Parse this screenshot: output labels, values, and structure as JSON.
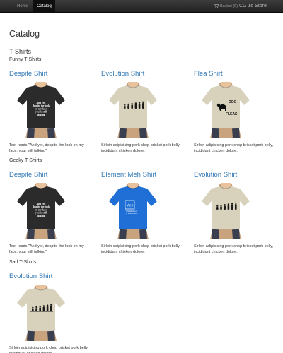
{
  "navbar": {
    "home_label": "Home",
    "catalog_label": "Catalog",
    "basket_label": "Basket (0)",
    "brand": "CG 16 Store"
  },
  "page_title": "Catalog",
  "section": {
    "title": "T-Shirts",
    "groups": [
      {
        "title": "Funny T-Shirts",
        "items": [
          {
            "title": "Despite Shirt",
            "shirt_color": "#2b2b2b",
            "print": "despite",
            "description": "Text reads \"And yet, despite the look on my face, your still talking\""
          },
          {
            "title": "Evolution Shirt",
            "shirt_color": "#d8d2bd",
            "print": "evolution",
            "description": "Sirloin adipisicing pork chop brisket pork belly, incididunt chicken dolore."
          },
          {
            "title": "Flea Shirt",
            "shirt_color": "#d8d2bd",
            "print": "flea",
            "description": "Sirloin adipisicing pork chop brisket pork belly, incididunt chicken dolore."
          }
        ]
      },
      {
        "title": "Geeky T-Shirts",
        "items": [
          {
            "title": "Despite Shirt",
            "shirt_color": "#2b2b2b",
            "print": "despite",
            "description": "Text reads \"And yet, despite the look on my face, your still talking\""
          },
          {
            "title": "Element Meh Shirt",
            "shirt_color": "#1f6fd6",
            "print": "meh",
            "description": "Sirloin adipisicing pork chop brisket pork belly, incididunt chicken dolore."
          },
          {
            "title": "Evolution Shirt",
            "shirt_color": "#d8d2bd",
            "print": "evolution",
            "description": "Sirloin adipisicing pork chop brisket pork belly, incididunt chicken dolore."
          }
        ]
      },
      {
        "title": "Sad T-Shirts",
        "items": [
          {
            "title": "Evolution Shirt",
            "shirt_color": "#d8d2bd",
            "print": "evolution",
            "description": "Sirloin adipisicing pork chop brisket pork belly, incididunt chicken dolore."
          }
        ]
      }
    ]
  },
  "prints": {
    "despite_lines": [
      "And yet,",
      "despite the look",
      "on my face,",
      "you're still",
      "talking"
    ],
    "flea_top": "DOG",
    "flea_bottom": "FLEAS",
    "meh_symbol": "Meh",
    "meh_caption_1": "The Element",
    "meh_caption_2": "of Indifference"
  },
  "colors": {
    "link": "#337ab7",
    "navbar": "#222222",
    "text": "#333333"
  },
  "icons": {
    "basket": "shopping-cart-icon"
  }
}
